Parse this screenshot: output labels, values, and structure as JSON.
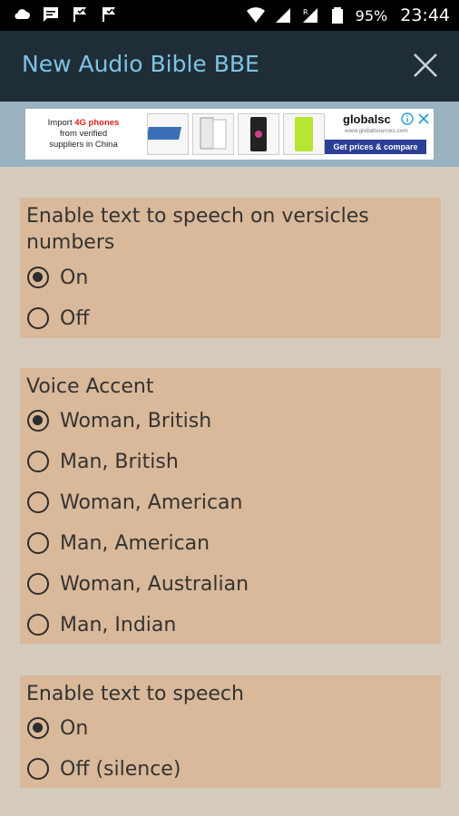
{
  "status_bar": {
    "battery_percent": "95%",
    "time": "23:44",
    "left_icons": [
      "cloud-icon",
      "message-icon",
      "check-flag-icon",
      "check-flag-icon"
    ],
    "right_icons": [
      "wifi-icon",
      "signal-icon",
      "signal-r-icon",
      "battery-icon"
    ]
  },
  "app_bar": {
    "title": "New Audio Bible BBE",
    "title_color": "#7ec3e6",
    "background": "#1f2e36"
  },
  "ad": {
    "line1_prefix": "Import ",
    "line1_highlight": "4G phones",
    "line2": "from verified",
    "line3": "suppliers in China",
    "brand": "globalsc",
    "brand_url": "www.globalsources.com",
    "cta": "Get prices & compare"
  },
  "groups": [
    {
      "title": "Enable text to speech on versicles numbers",
      "options": [
        {
          "label": "On",
          "checked": true
        },
        {
          "label": "Off",
          "checked": false
        }
      ]
    },
    {
      "title": "Voice Accent",
      "options": [
        {
          "label": "Woman, British",
          "checked": true
        },
        {
          "label": "Man, British",
          "checked": false
        },
        {
          "label": "Woman, American",
          "checked": false
        },
        {
          "label": "Man, American",
          "checked": false
        },
        {
          "label": "Woman, Australian",
          "checked": false
        },
        {
          "label": "Man, Indian",
          "checked": false
        }
      ]
    },
    {
      "title": "Enable text to speech",
      "options": [
        {
          "label": "On",
          "checked": true
        },
        {
          "label": "Off (silence)",
          "checked": false
        }
      ]
    }
  ]
}
